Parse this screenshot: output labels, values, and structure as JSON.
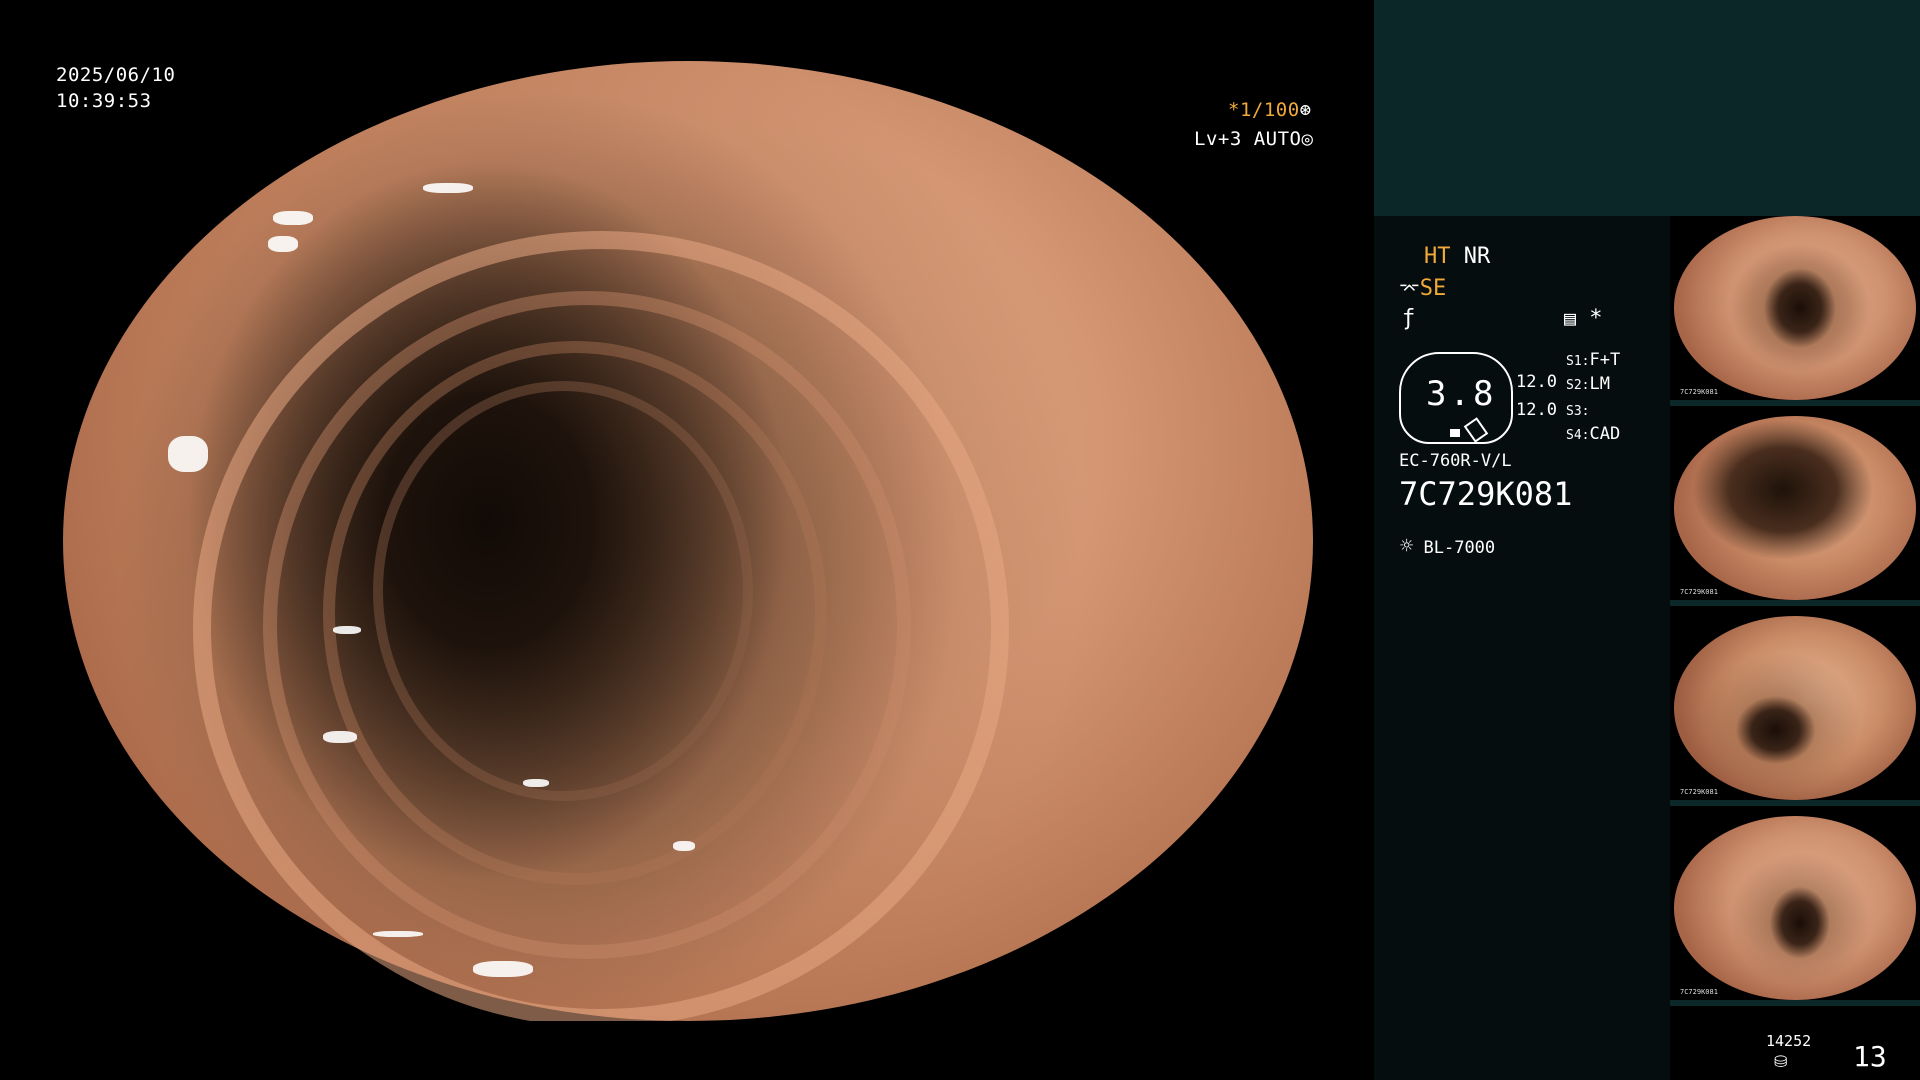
{
  "overlay": {
    "date": "2025/06/10",
    "time": "10:39:53",
    "shutter": "*1/100",
    "level": "Lv+3",
    "iris": "AUTO"
  },
  "panel": {
    "ht": "HT",
    "nr": "NR",
    "se": "SE",
    "star": "*",
    "zoom_value": "3.8",
    "value_a": "12.0",
    "value_b": "12.0",
    "s1_key": "S1:",
    "s1_val": "F+T",
    "s2_key": "S2:",
    "s2_val": "LM",
    "s3_key": "S3:",
    "s3_val": "",
    "s4_key": "S4:",
    "s4_val": "CAD",
    "scope_model": "EC-760R-V/L",
    "scope_serial": "7C729K081",
    "light_source": "BL-7000",
    "counter": "14252",
    "image_count": "13"
  },
  "thumbs": [
    {
      "label": "7C729K081"
    },
    {
      "label": "7C729K081"
    },
    {
      "label": "7C729K081"
    },
    {
      "label": "7C729K081"
    }
  ],
  "colors": {
    "accent_orange": "#f0a93a",
    "panel_teal": "#0b2728",
    "panel_dark": "#060d0e"
  }
}
